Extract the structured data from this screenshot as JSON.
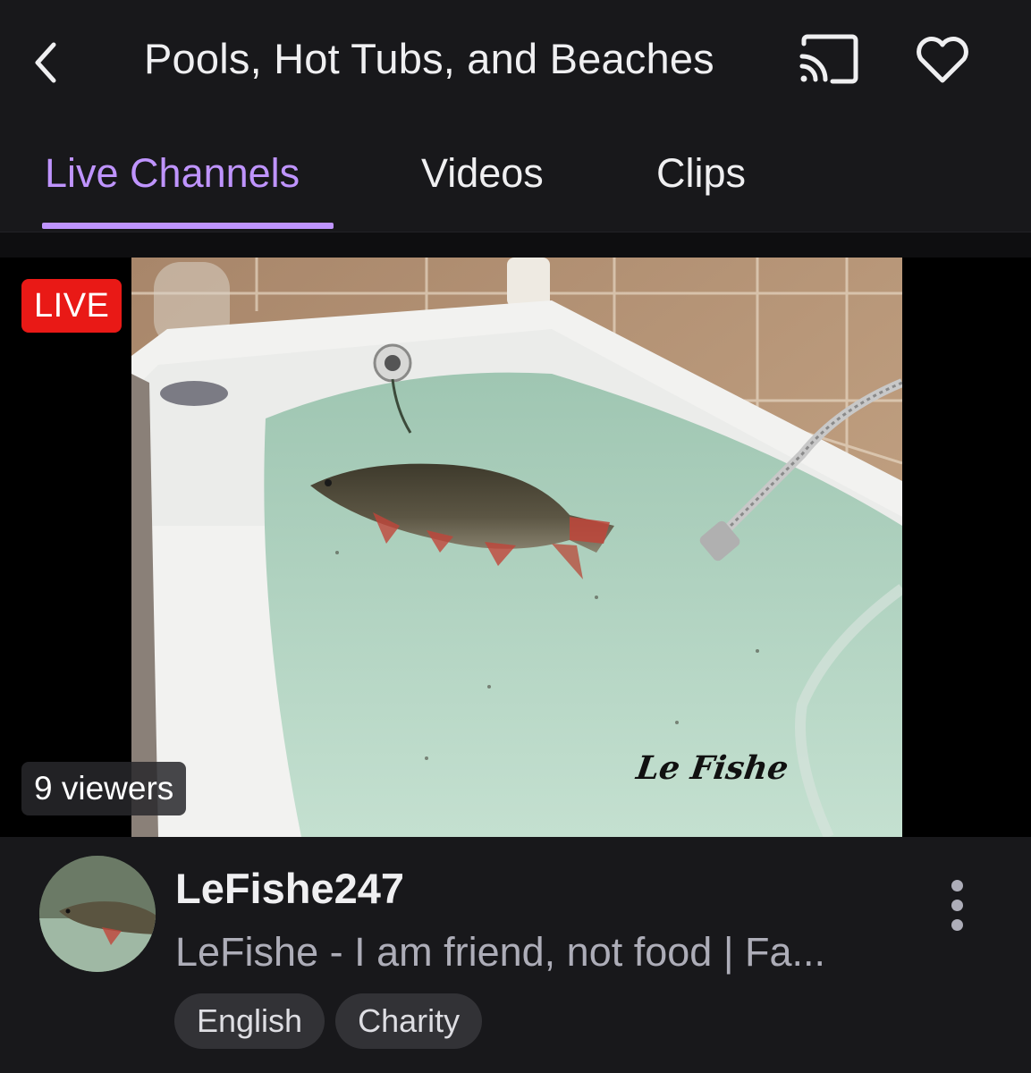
{
  "header": {
    "back_icon": "chevron-left-icon",
    "title": "Pools, Hot Tubs, and Beaches",
    "cast_icon": "cast-icon",
    "follow_icon": "heart-outline-icon"
  },
  "tabs": [
    {
      "label": "Live Channels",
      "active": true
    },
    {
      "label": "Videos",
      "active": false
    },
    {
      "label": "Clips",
      "active": false
    }
  ],
  "stream": {
    "live_badge": "LIVE",
    "viewers": "9 viewers",
    "thumbnail_watermark": "Le Fishe",
    "channel_name": "LeFishe247",
    "title": "LeFishe - I am friend, not food | Fa...",
    "tags": [
      "English",
      "Charity"
    ],
    "menu_icon": "more-vertical-icon"
  },
  "colors": {
    "accent": "#bf94ff",
    "live_red": "#e91916",
    "background": "#0e0e10",
    "surface": "#18181b",
    "tag_bg": "#323236",
    "secondary_text": "#adadb8"
  }
}
